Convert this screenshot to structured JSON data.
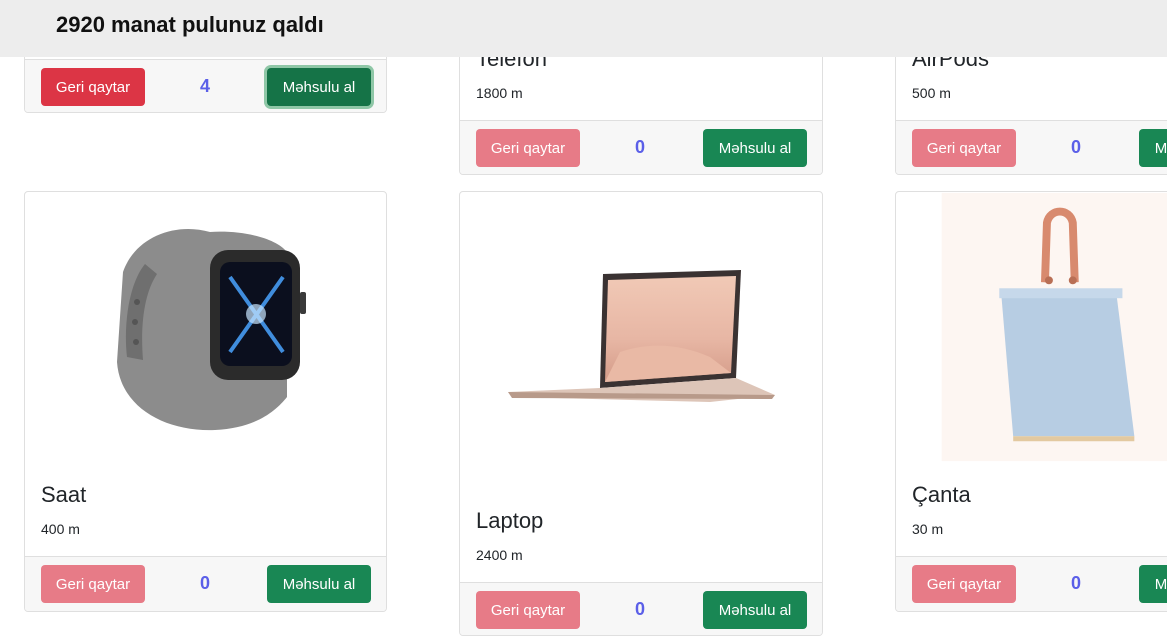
{
  "header": {
    "balance_text": "2920 manat pulunuz qaldı"
  },
  "products": [
    {
      "name": "",
      "price": "",
      "count": "4",
      "return_label": "Geri qaytar",
      "buy_label": "Məhsulu al"
    },
    {
      "name": "Telefon",
      "price": "1800 m",
      "count": "0",
      "return_label": "Geri qaytar",
      "buy_label": "Məhsulu al"
    },
    {
      "name": "AirPods",
      "price": "500 m",
      "count": "0",
      "return_label": "Geri qaytar",
      "buy_label": "Məhsulu al"
    },
    {
      "name": "Saat",
      "price": "400 m",
      "count": "0",
      "return_label": "Geri qaytar",
      "buy_label": "Məhsulu al"
    },
    {
      "name": "Laptop",
      "price": "2400 m",
      "count": "0",
      "return_label": "Geri qaytar",
      "buy_label": "Məhsulu al"
    },
    {
      "name": "Çanta",
      "price": "30 m",
      "count": "0",
      "return_label": "Geri qaytar",
      "buy_label": "Məhsulu al"
    }
  ],
  "colors": {
    "return_active": "#dc3545",
    "return_disabled": "#e77b87",
    "buy": "#198754",
    "count": "#5b5fe8"
  }
}
